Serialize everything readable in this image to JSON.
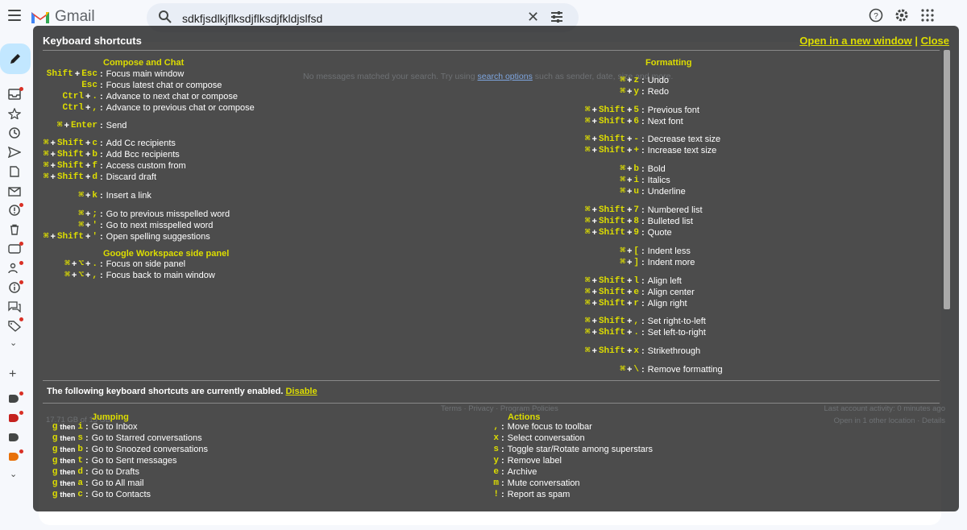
{
  "app": {
    "logo_text": "Gmail",
    "search_value": "sdkfjsdlkjflksdjflksdjfkldjslfsd"
  },
  "background": {
    "no_messages_prefix": "No messages matched your search. Try using",
    "search_options_link": "search options",
    "no_messages_suffix": "such as sender, date, size and more.",
    "footer_links": "Terms · Privacy · Program Policies",
    "last_activity": "Last account activity: 0 minutes ago",
    "open_location": "Open in 1 other location · Details",
    "storage": "17.71 GB of 15 GB"
  },
  "overlay": {
    "title": "Keyboard shortcuts",
    "open_new_window": "Open in a new window",
    "separator": "|",
    "close": "Close",
    "enabled_text": "The following keyboard shortcuts are currently enabled.",
    "disable_link": "Disable",
    "sections": {
      "compose": "Compose and Chat",
      "workspace": "Google Workspace side panel",
      "formatting": "Formatting",
      "jumping": "Jumping",
      "actions": "Actions"
    },
    "compose_rows": [
      {
        "keys": [
          "Shift",
          "Esc"
        ],
        "desc": "Focus main window"
      },
      {
        "keys": [
          "Esc"
        ],
        "desc": "Focus latest chat or compose"
      },
      {
        "keys": [
          "Ctrl",
          "."
        ],
        "desc": "Advance to next chat or compose"
      },
      {
        "keys": [
          "Ctrl",
          ","
        ],
        "desc": "Advance to previous chat or compose"
      },
      {
        "keys": [
          "⌘",
          "Enter"
        ],
        "desc": "Send"
      },
      {
        "keys": [
          "⌘",
          "Shift",
          "c"
        ],
        "desc": "Add Cc recipients"
      },
      {
        "keys": [
          "⌘",
          "Shift",
          "b"
        ],
        "desc": "Add Bcc recipients"
      },
      {
        "keys": [
          "⌘",
          "Shift",
          "f"
        ],
        "desc": "Access custom from"
      },
      {
        "keys": [
          "⌘",
          "Shift",
          "d"
        ],
        "desc": "Discard draft"
      },
      {
        "keys": [
          "⌘",
          "k"
        ],
        "desc": "Insert a link"
      },
      {
        "keys": [
          "⌘",
          ";"
        ],
        "desc": "Go to previous misspelled word"
      },
      {
        "keys": [
          "⌘",
          "'"
        ],
        "desc": "Go to next misspelled word"
      },
      {
        "keys": [
          "⌘",
          "Shift",
          "'"
        ],
        "desc": "Open spelling suggestions"
      }
    ],
    "workspace_rows": [
      {
        "keys": [
          "⌘",
          "⌥",
          "."
        ],
        "desc": "Focus on side panel"
      },
      {
        "keys": [
          "⌘",
          "⌥",
          ","
        ],
        "desc": "Focus back to main window"
      }
    ],
    "formatting_rows": [
      {
        "keys": [
          "⌘",
          "z"
        ],
        "desc": "Undo"
      },
      {
        "keys": [
          "⌘",
          "y"
        ],
        "desc": "Redo"
      },
      {
        "keys": [
          "⌘",
          "Shift",
          "5"
        ],
        "desc": "Previous font"
      },
      {
        "keys": [
          "⌘",
          "Shift",
          "6"
        ],
        "desc": "Next font"
      },
      {
        "keys": [
          "⌘",
          "Shift",
          "-"
        ],
        "desc": "Decrease text size"
      },
      {
        "keys": [
          "⌘",
          "Shift",
          "+"
        ],
        "desc": "Increase text size"
      },
      {
        "keys": [
          "⌘",
          "b"
        ],
        "desc": "Bold"
      },
      {
        "keys": [
          "⌘",
          "i"
        ],
        "desc": "Italics"
      },
      {
        "keys": [
          "⌘",
          "u"
        ],
        "desc": "Underline"
      },
      {
        "keys": [
          "⌘",
          "Shift",
          "7"
        ],
        "desc": "Numbered list"
      },
      {
        "keys": [
          "⌘",
          "Shift",
          "8"
        ],
        "desc": "Bulleted list"
      },
      {
        "keys": [
          "⌘",
          "Shift",
          "9"
        ],
        "desc": "Quote"
      },
      {
        "keys": [
          "⌘",
          "["
        ],
        "desc": "Indent less"
      },
      {
        "keys": [
          "⌘",
          "]"
        ],
        "desc": "Indent more"
      },
      {
        "keys": [
          "⌘",
          "Shift",
          "l"
        ],
        "desc": "Align left"
      },
      {
        "keys": [
          "⌘",
          "Shift",
          "e"
        ],
        "desc": "Align center"
      },
      {
        "keys": [
          "⌘",
          "Shift",
          "r"
        ],
        "desc": "Align right"
      },
      {
        "keys": [
          "⌘",
          "Shift",
          ","
        ],
        "desc": "Set right-to-left"
      },
      {
        "keys": [
          "⌘",
          "Shift",
          "."
        ],
        "desc": "Set left-to-right"
      },
      {
        "keys": [
          "⌘",
          "Shift",
          "x"
        ],
        "desc": "Strikethrough"
      },
      {
        "keys": [
          "⌘",
          "\\"
        ],
        "desc": "Remove formatting"
      }
    ],
    "then_word": "then",
    "jumping_rows": [
      {
        "keys": [
          "g",
          "i"
        ],
        "desc": "Go to Inbox"
      },
      {
        "keys": [
          "g",
          "s"
        ],
        "desc": "Go to Starred conversations"
      },
      {
        "keys": [
          "g",
          "b"
        ],
        "desc": "Go to Snoozed conversations"
      },
      {
        "keys": [
          "g",
          "t"
        ],
        "desc": "Go to Sent messages"
      },
      {
        "keys": [
          "g",
          "d"
        ],
        "desc": "Go to Drafts"
      },
      {
        "keys": [
          "g",
          "a"
        ],
        "desc": "Go to All mail"
      },
      {
        "keys": [
          "g",
          "c"
        ],
        "desc": "Go to Contacts"
      }
    ],
    "actions_rows": [
      {
        "keys": [
          ","
        ],
        "desc": "Move focus to toolbar"
      },
      {
        "keys": [
          "x"
        ],
        "desc": "Select conversation"
      },
      {
        "keys": [
          "s"
        ],
        "desc": "Toggle star/Rotate among superstars"
      },
      {
        "keys": [
          "y"
        ],
        "desc": "Remove label"
      },
      {
        "keys": [
          "e"
        ],
        "desc": "Archive"
      },
      {
        "keys": [
          "m"
        ],
        "desc": "Mute conversation"
      },
      {
        "keys": [
          "!"
        ],
        "desc": "Report as spam"
      }
    ]
  },
  "colors": {
    "key_yellow": "#dddd00",
    "overlay_bg": "rgba(0,0,0,0.70)",
    "compose_fab": "#c2e7ff"
  },
  "icons": [
    "menu-icon",
    "search-icon",
    "clear-icon",
    "tune-icon",
    "help-icon",
    "settings-icon",
    "apps-icon",
    "pencil-icon"
  ]
}
